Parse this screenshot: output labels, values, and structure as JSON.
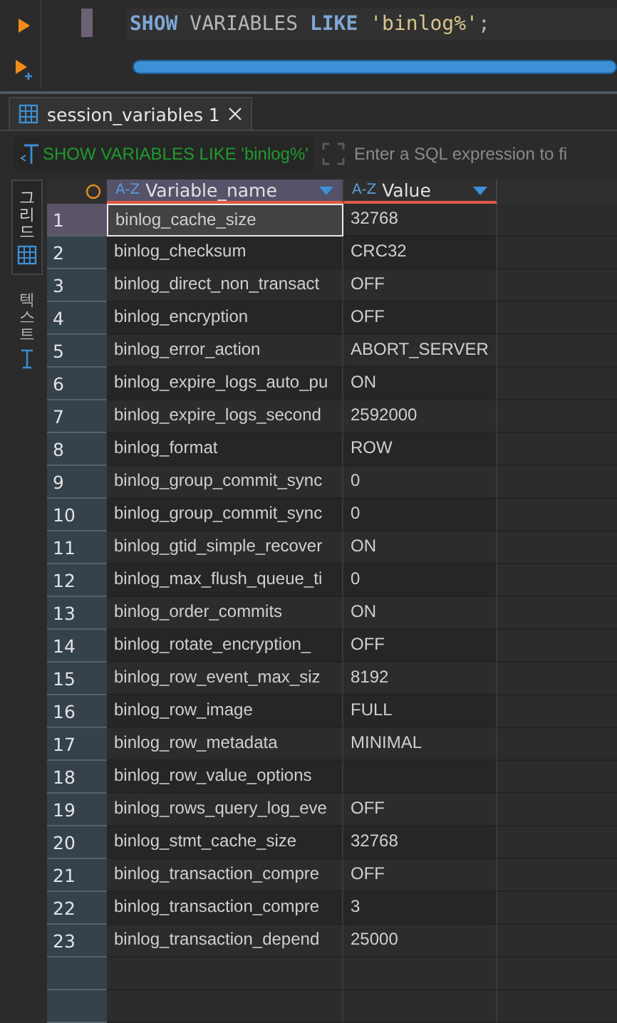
{
  "editor": {
    "line_tokens": [
      {
        "kind": "keyword",
        "text": "SHOW"
      },
      {
        "kind": "plain",
        "text": "VARIABLES"
      },
      {
        "kind": "keyword",
        "text": "LIKE"
      },
      {
        "kind": "string",
        "text": "'binlog%'"
      },
      {
        "kind": "plain",
        "text": ";"
      }
    ]
  },
  "result_tab": {
    "label": "session_variables 1",
    "selected": true
  },
  "filter_bar": {
    "query": "SHOW VARIABLES LIKE 'binlog%'",
    "placeholder": "Enter a SQL expression to fi"
  },
  "side_tabs": [
    {
      "label": "그리드",
      "selected": true
    },
    {
      "label": "텍스트",
      "selected": false
    }
  ],
  "table": {
    "columns": [
      {
        "type_label": "A-Z",
        "label": "Variable_name",
        "selected": true
      },
      {
        "type_label": "A-Z",
        "label": "Value",
        "selected": false
      }
    ],
    "rows": [
      {
        "number": "1",
        "name": "binlog_cache_size",
        "value": "32768",
        "selected": true
      },
      {
        "number": "2",
        "name": "binlog_checksum",
        "value": "CRC32",
        "selected": false
      },
      {
        "number": "3",
        "name": "binlog_direct_non_transact",
        "value": "OFF",
        "selected": false
      },
      {
        "number": "4",
        "name": "binlog_encryption",
        "value": "OFF",
        "selected": false
      },
      {
        "number": "5",
        "name": "binlog_error_action",
        "value": "ABORT_SERVER",
        "selected": false
      },
      {
        "number": "6",
        "name": "binlog_expire_logs_auto_pu",
        "value": "ON",
        "selected": false
      },
      {
        "number": "7",
        "name": "binlog_expire_logs_second",
        "value": "2592000",
        "selected": false
      },
      {
        "number": "8",
        "name": "binlog_format",
        "value": "ROW",
        "selected": false
      },
      {
        "number": "9",
        "name": "binlog_group_commit_sync",
        "value": "0",
        "selected": false
      },
      {
        "number": "10",
        "name": "binlog_group_commit_sync",
        "value": "0",
        "selected": false
      },
      {
        "number": "11",
        "name": "binlog_gtid_simple_recover",
        "value": "ON",
        "selected": false
      },
      {
        "number": "12",
        "name": "binlog_max_flush_queue_ti",
        "value": "0",
        "selected": false
      },
      {
        "number": "13",
        "name": "binlog_order_commits",
        "value": "ON",
        "selected": false
      },
      {
        "number": "14",
        "name": "binlog_rotate_encryption_",
        "value": "OFF",
        "selected": false
      },
      {
        "number": "15",
        "name": "binlog_row_event_max_siz",
        "value": "8192",
        "selected": false
      },
      {
        "number": "16",
        "name": "binlog_row_image",
        "value": "FULL",
        "selected": false
      },
      {
        "number": "17",
        "name": "binlog_row_metadata",
        "value": "MINIMAL",
        "selected": false
      },
      {
        "number": "18",
        "name": "binlog_row_value_options",
        "selected": false
      },
      {
        "number": "19",
        "name": "binlog_rows_query_log_eve",
        "value": "OFF",
        "selected": false
      },
      {
        "number": "20",
        "name": "binlog_stmt_cache_size",
        "value": "32768",
        "selected": false
      },
      {
        "number": "21",
        "name": "binlog_transaction_compre",
        "value": "OFF",
        "selected": false
      },
      {
        "number": "22",
        "name": "binlog_transaction_compre",
        "value": "3",
        "selected": false
      },
      {
        "number": "23",
        "name": "binlog_transaction_depend",
        "value": "25000",
        "selected": false
      }
    ]
  }
}
